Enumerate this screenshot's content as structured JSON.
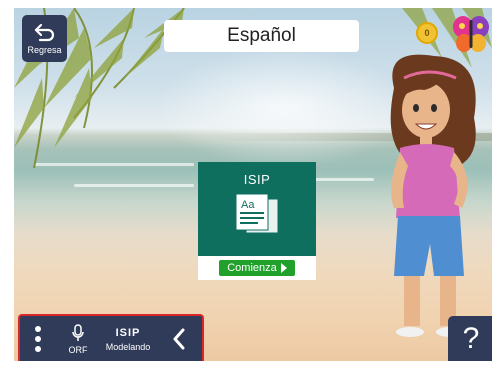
{
  "header": {
    "back_label": "Regresa",
    "title": "Español",
    "coins": "0"
  },
  "activity_card": {
    "title": "ISIP",
    "start_label": "Comienza"
  },
  "toolbar": {
    "orf_label": "ORF",
    "isip_logo": "ISIP",
    "modeling_label": "Modelando"
  },
  "help": {
    "label": "?"
  },
  "icons": {
    "back": "undo-arrow-icon",
    "coin": "coin-icon",
    "avatar": "butterfly-icon",
    "document": "document-icon",
    "menu": "more-vertical-icon",
    "mic": "microphone-icon",
    "collapse": "chevron-left-icon"
  },
  "colors": {
    "panel": "#2f3b59",
    "card": "#0f6f5f",
    "start_button": "#21a02c",
    "toolbar_border": "#d9262b",
    "coin": "#f1c232"
  }
}
